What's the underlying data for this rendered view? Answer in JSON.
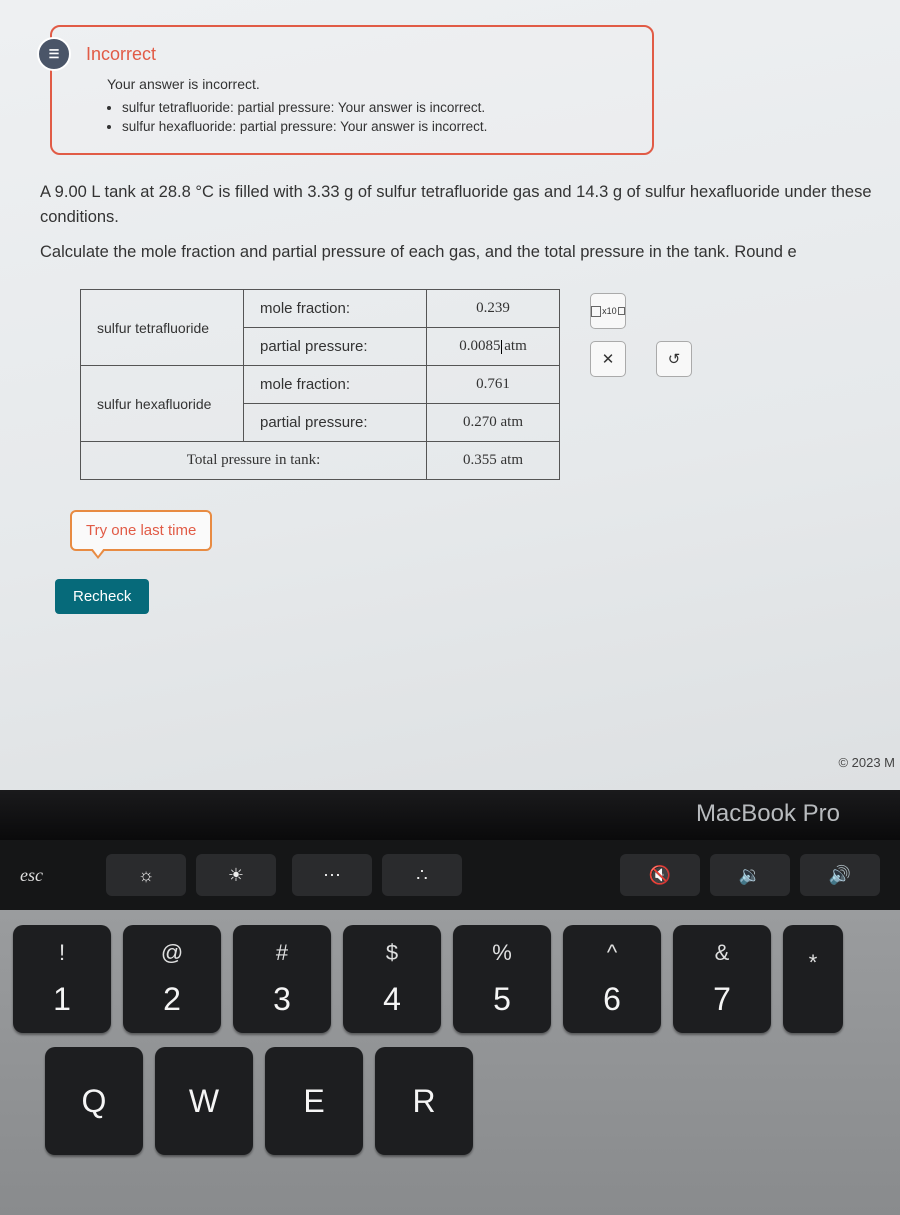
{
  "feedback": {
    "status": "Incorrect",
    "subtext": "Your answer is incorrect.",
    "items": [
      "sulfur tetrafluoride: partial pressure: Your answer is incorrect.",
      "sulfur hexafluoride: partial pressure: Your answer is incorrect."
    ]
  },
  "problem": {
    "line1": "A 9.00 L tank at 28.8 °C is filled with 3.33 g of sulfur tetrafluoride gas and 14.3 g of sulfur hexafluoride under these conditions.",
    "line2": "Calculate the mole fraction and partial pressure of each gas, and the total pressure in the tank. Round e"
  },
  "table": {
    "row1_name": "sulfur tetrafluoride",
    "row1_mf_label": "mole fraction:",
    "row1_mf_val": "0.239",
    "row1_pp_label": "partial pressure:",
    "row1_pp_val": "0.0085 atm",
    "row2_name": "sulfur hexafluoride",
    "row2_mf_label": "mole fraction:",
    "row2_mf_val": "0.761",
    "row2_pp_label": "partial pressure:",
    "row2_pp_val": "0.270 atm",
    "total_label": "Total pressure in tank:",
    "total_val": "0.355 atm"
  },
  "tools": {
    "sci": "x10",
    "clear": "✕",
    "reset": "↺"
  },
  "buttons": {
    "try": "Try one last time",
    "recheck": "Recheck"
  },
  "copyright": "© 2023 M",
  "laptop": "MacBook Pro",
  "touchbar": {
    "esc": "esc",
    "bright_down": "☼",
    "bright_up": "☀",
    "keys_dim": "⋯",
    "keys_bright": "∴",
    "mute": "🔇",
    "vol_down": "🔉",
    "vol_up": "🔊"
  },
  "keys": {
    "k1": {
      "top": "!",
      "bot": "1"
    },
    "k2": {
      "top": "@",
      "bot": "2"
    },
    "k3": {
      "top": "#",
      "bot": "3"
    },
    "k4": {
      "top": "$",
      "bot": "4"
    },
    "k5": {
      "top": "%",
      "bot": "5"
    },
    "k6": {
      "top": "^",
      "bot": "6"
    },
    "k7": {
      "top": "&",
      "bot": "7"
    },
    "k8": {
      "top": "*",
      "bot": ""
    },
    "q": "Q",
    "w": "W",
    "e": "E",
    "r": "R"
  }
}
